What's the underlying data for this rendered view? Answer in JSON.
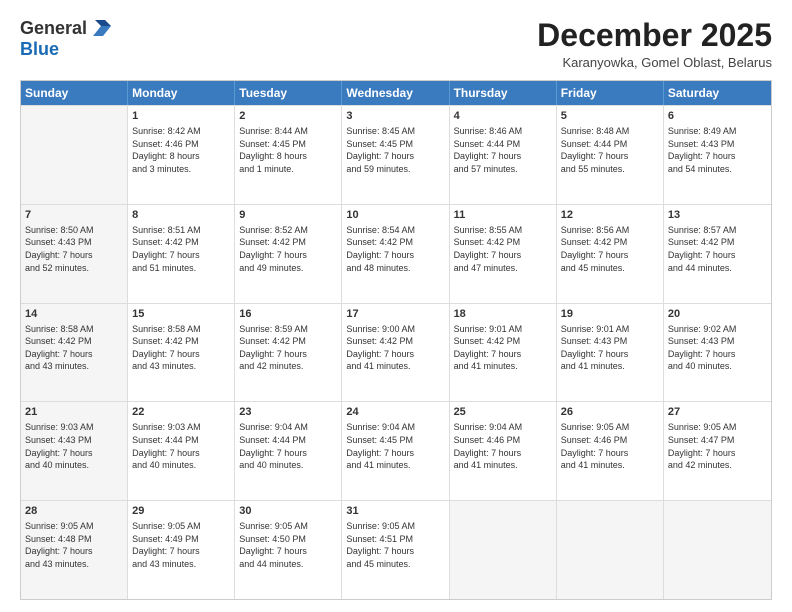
{
  "header": {
    "logo_line1": "General",
    "logo_line2": "Blue",
    "month": "December 2025",
    "location": "Karanyowka, Gomel Oblast, Belarus"
  },
  "days_of_week": [
    "Sunday",
    "Monday",
    "Tuesday",
    "Wednesday",
    "Thursday",
    "Friday",
    "Saturday"
  ],
  "weeks": [
    [
      {
        "day": "",
        "text": "",
        "shaded": true
      },
      {
        "day": "1",
        "text": "Sunrise: 8:42 AM\nSunset: 4:46 PM\nDaylight: 8 hours\nand 3 minutes.",
        "shaded": false
      },
      {
        "day": "2",
        "text": "Sunrise: 8:44 AM\nSunset: 4:45 PM\nDaylight: 8 hours\nand 1 minute.",
        "shaded": false
      },
      {
        "day": "3",
        "text": "Sunrise: 8:45 AM\nSunset: 4:45 PM\nDaylight: 7 hours\nand 59 minutes.",
        "shaded": false
      },
      {
        "day": "4",
        "text": "Sunrise: 8:46 AM\nSunset: 4:44 PM\nDaylight: 7 hours\nand 57 minutes.",
        "shaded": false
      },
      {
        "day": "5",
        "text": "Sunrise: 8:48 AM\nSunset: 4:44 PM\nDaylight: 7 hours\nand 55 minutes.",
        "shaded": false
      },
      {
        "day": "6",
        "text": "Sunrise: 8:49 AM\nSunset: 4:43 PM\nDaylight: 7 hours\nand 54 minutes.",
        "shaded": false
      }
    ],
    [
      {
        "day": "7",
        "text": "Sunrise: 8:50 AM\nSunset: 4:43 PM\nDaylight: 7 hours\nand 52 minutes.",
        "shaded": true
      },
      {
        "day": "8",
        "text": "Sunrise: 8:51 AM\nSunset: 4:42 PM\nDaylight: 7 hours\nand 51 minutes.",
        "shaded": false
      },
      {
        "day": "9",
        "text": "Sunrise: 8:52 AM\nSunset: 4:42 PM\nDaylight: 7 hours\nand 49 minutes.",
        "shaded": false
      },
      {
        "day": "10",
        "text": "Sunrise: 8:54 AM\nSunset: 4:42 PM\nDaylight: 7 hours\nand 48 minutes.",
        "shaded": false
      },
      {
        "day": "11",
        "text": "Sunrise: 8:55 AM\nSunset: 4:42 PM\nDaylight: 7 hours\nand 47 minutes.",
        "shaded": false
      },
      {
        "day": "12",
        "text": "Sunrise: 8:56 AM\nSunset: 4:42 PM\nDaylight: 7 hours\nand 45 minutes.",
        "shaded": false
      },
      {
        "day": "13",
        "text": "Sunrise: 8:57 AM\nSunset: 4:42 PM\nDaylight: 7 hours\nand 44 minutes.",
        "shaded": false
      }
    ],
    [
      {
        "day": "14",
        "text": "Sunrise: 8:58 AM\nSunset: 4:42 PM\nDaylight: 7 hours\nand 43 minutes.",
        "shaded": true
      },
      {
        "day": "15",
        "text": "Sunrise: 8:58 AM\nSunset: 4:42 PM\nDaylight: 7 hours\nand 43 minutes.",
        "shaded": false
      },
      {
        "day": "16",
        "text": "Sunrise: 8:59 AM\nSunset: 4:42 PM\nDaylight: 7 hours\nand 42 minutes.",
        "shaded": false
      },
      {
        "day": "17",
        "text": "Sunrise: 9:00 AM\nSunset: 4:42 PM\nDaylight: 7 hours\nand 41 minutes.",
        "shaded": false
      },
      {
        "day": "18",
        "text": "Sunrise: 9:01 AM\nSunset: 4:42 PM\nDaylight: 7 hours\nand 41 minutes.",
        "shaded": false
      },
      {
        "day": "19",
        "text": "Sunrise: 9:01 AM\nSunset: 4:43 PM\nDaylight: 7 hours\nand 41 minutes.",
        "shaded": false
      },
      {
        "day": "20",
        "text": "Sunrise: 9:02 AM\nSunset: 4:43 PM\nDaylight: 7 hours\nand 40 minutes.",
        "shaded": false
      }
    ],
    [
      {
        "day": "21",
        "text": "Sunrise: 9:03 AM\nSunset: 4:43 PM\nDaylight: 7 hours\nand 40 minutes.",
        "shaded": true
      },
      {
        "day": "22",
        "text": "Sunrise: 9:03 AM\nSunset: 4:44 PM\nDaylight: 7 hours\nand 40 minutes.",
        "shaded": false
      },
      {
        "day": "23",
        "text": "Sunrise: 9:04 AM\nSunset: 4:44 PM\nDaylight: 7 hours\nand 40 minutes.",
        "shaded": false
      },
      {
        "day": "24",
        "text": "Sunrise: 9:04 AM\nSunset: 4:45 PM\nDaylight: 7 hours\nand 41 minutes.",
        "shaded": false
      },
      {
        "day": "25",
        "text": "Sunrise: 9:04 AM\nSunset: 4:46 PM\nDaylight: 7 hours\nand 41 minutes.",
        "shaded": false
      },
      {
        "day": "26",
        "text": "Sunrise: 9:05 AM\nSunset: 4:46 PM\nDaylight: 7 hours\nand 41 minutes.",
        "shaded": false
      },
      {
        "day": "27",
        "text": "Sunrise: 9:05 AM\nSunset: 4:47 PM\nDaylight: 7 hours\nand 42 minutes.",
        "shaded": false
      }
    ],
    [
      {
        "day": "28",
        "text": "Sunrise: 9:05 AM\nSunset: 4:48 PM\nDaylight: 7 hours\nand 43 minutes.",
        "shaded": true
      },
      {
        "day": "29",
        "text": "Sunrise: 9:05 AM\nSunset: 4:49 PM\nDaylight: 7 hours\nand 43 minutes.",
        "shaded": false
      },
      {
        "day": "30",
        "text": "Sunrise: 9:05 AM\nSunset: 4:50 PM\nDaylight: 7 hours\nand 44 minutes.",
        "shaded": false
      },
      {
        "day": "31",
        "text": "Sunrise: 9:05 AM\nSunset: 4:51 PM\nDaylight: 7 hours\nand 45 minutes.",
        "shaded": false
      },
      {
        "day": "",
        "text": "",
        "shaded": true
      },
      {
        "day": "",
        "text": "",
        "shaded": true
      },
      {
        "day": "",
        "text": "",
        "shaded": true
      }
    ]
  ]
}
